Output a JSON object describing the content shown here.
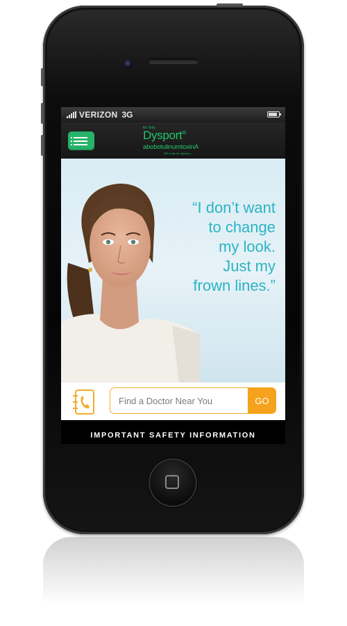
{
  "status_bar": {
    "carrier": "VERIZON",
    "network": "3G"
  },
  "header": {
    "menu_icon": "hamburger-menu-icon",
    "logo": {
      "top_line": "for Only",
      "brand": "Dysport",
      "registered_mark": "®",
      "generic_name": "abobotulinumtoxinA",
      "dose_line": "300 Units for Injection"
    }
  },
  "hero": {
    "quote_lines": [
      "“I don’t want",
      "to change",
      "my look.",
      "Just my",
      "frown lines.”"
    ]
  },
  "doctor_finder": {
    "icon": "address-book-phone-icon",
    "placeholder": "Find a Doctor Near You",
    "go_label": "GO"
  },
  "footer": {
    "safety_label": "IMPORTANT SAFETY INFORMATION"
  },
  "colors": {
    "brand_green": "#22c56c",
    "menu_green": "#27b36a",
    "quote_teal": "#2cb3c4",
    "accent_orange": "#f5a21c"
  }
}
